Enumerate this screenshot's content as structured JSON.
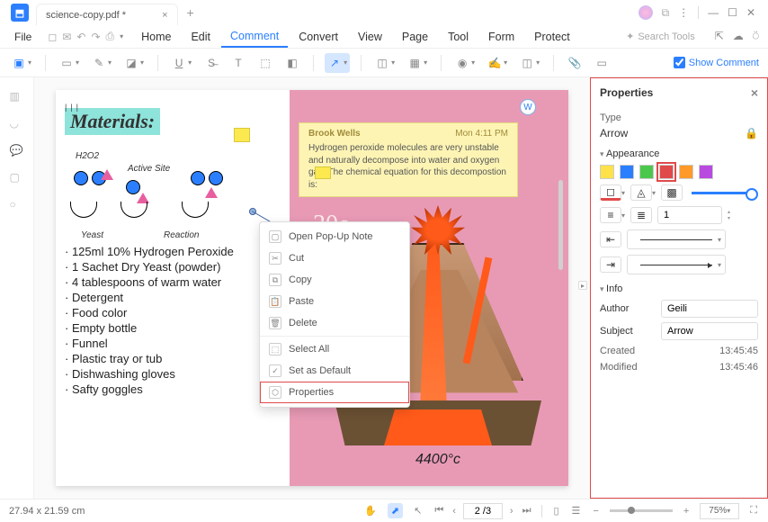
{
  "tab": {
    "title": "science-copy.pdf *"
  },
  "menubar": {
    "file": "File",
    "items": [
      "Home",
      "Edit",
      "Comment",
      "Convert",
      "View",
      "Page",
      "Tool",
      "Form",
      "Protect"
    ],
    "active": "Comment",
    "search_placeholder": "Search Tools"
  },
  "toolbar": {
    "show_comment": "Show Comment"
  },
  "page": {
    "doodle": "|||",
    "heading": "Materials:",
    "mol_labels": {
      "h2o2": "H2O2",
      "active": "Active Site",
      "yeast": "Yeast",
      "reaction": "Reaction"
    },
    "list": [
      "· 125ml 10% Hydrogen Peroxide",
      "· 1 Sachet Dry Yeast (powder)",
      "· 4 tablespoons of warm water",
      "· Detergent",
      "· Food color",
      "· Empty bottle",
      "· Funnel",
      "· Plastic tray or tub",
      "· Dishwashing gloves",
      "· Safty goggles"
    ],
    "note": {
      "author": "Brook Wells",
      "time": "Mon 4:11 PM",
      "body": "Hydrogen peroxide molecules are very unstable and naturally decompose into water and oxygen gas. The chemical equation for this decompostion is:"
    },
    "thirty": "30o",
    "temp": "4400°c"
  },
  "ctx": {
    "items": [
      "Open Pop-Up Note",
      "Cut",
      "Copy",
      "Paste",
      "Delete",
      "Select All",
      "Set as Default",
      "Properties"
    ]
  },
  "panel": {
    "title": "Properties",
    "type_label": "Type",
    "type_value": "Arrow",
    "appearance": "Appearance",
    "swatches": [
      "#ffe24a",
      "#2b7fff",
      "#4bc84b",
      "#e04a4a",
      "#ff9a2a",
      "#b84ae0"
    ],
    "selected_swatch": 3,
    "thickness_value": "1",
    "info": "Info",
    "author_label": "Author",
    "author_value": "Geili",
    "subject_label": "Subject",
    "subject_value": "Arrow",
    "created_label": "Created",
    "created_value": "13:45:45",
    "modified_label": "Modified",
    "modified_value": "13:45:46"
  },
  "status": {
    "dims": "27.94 x 21.59 cm",
    "page": "2 /3",
    "zoom": "75%"
  }
}
